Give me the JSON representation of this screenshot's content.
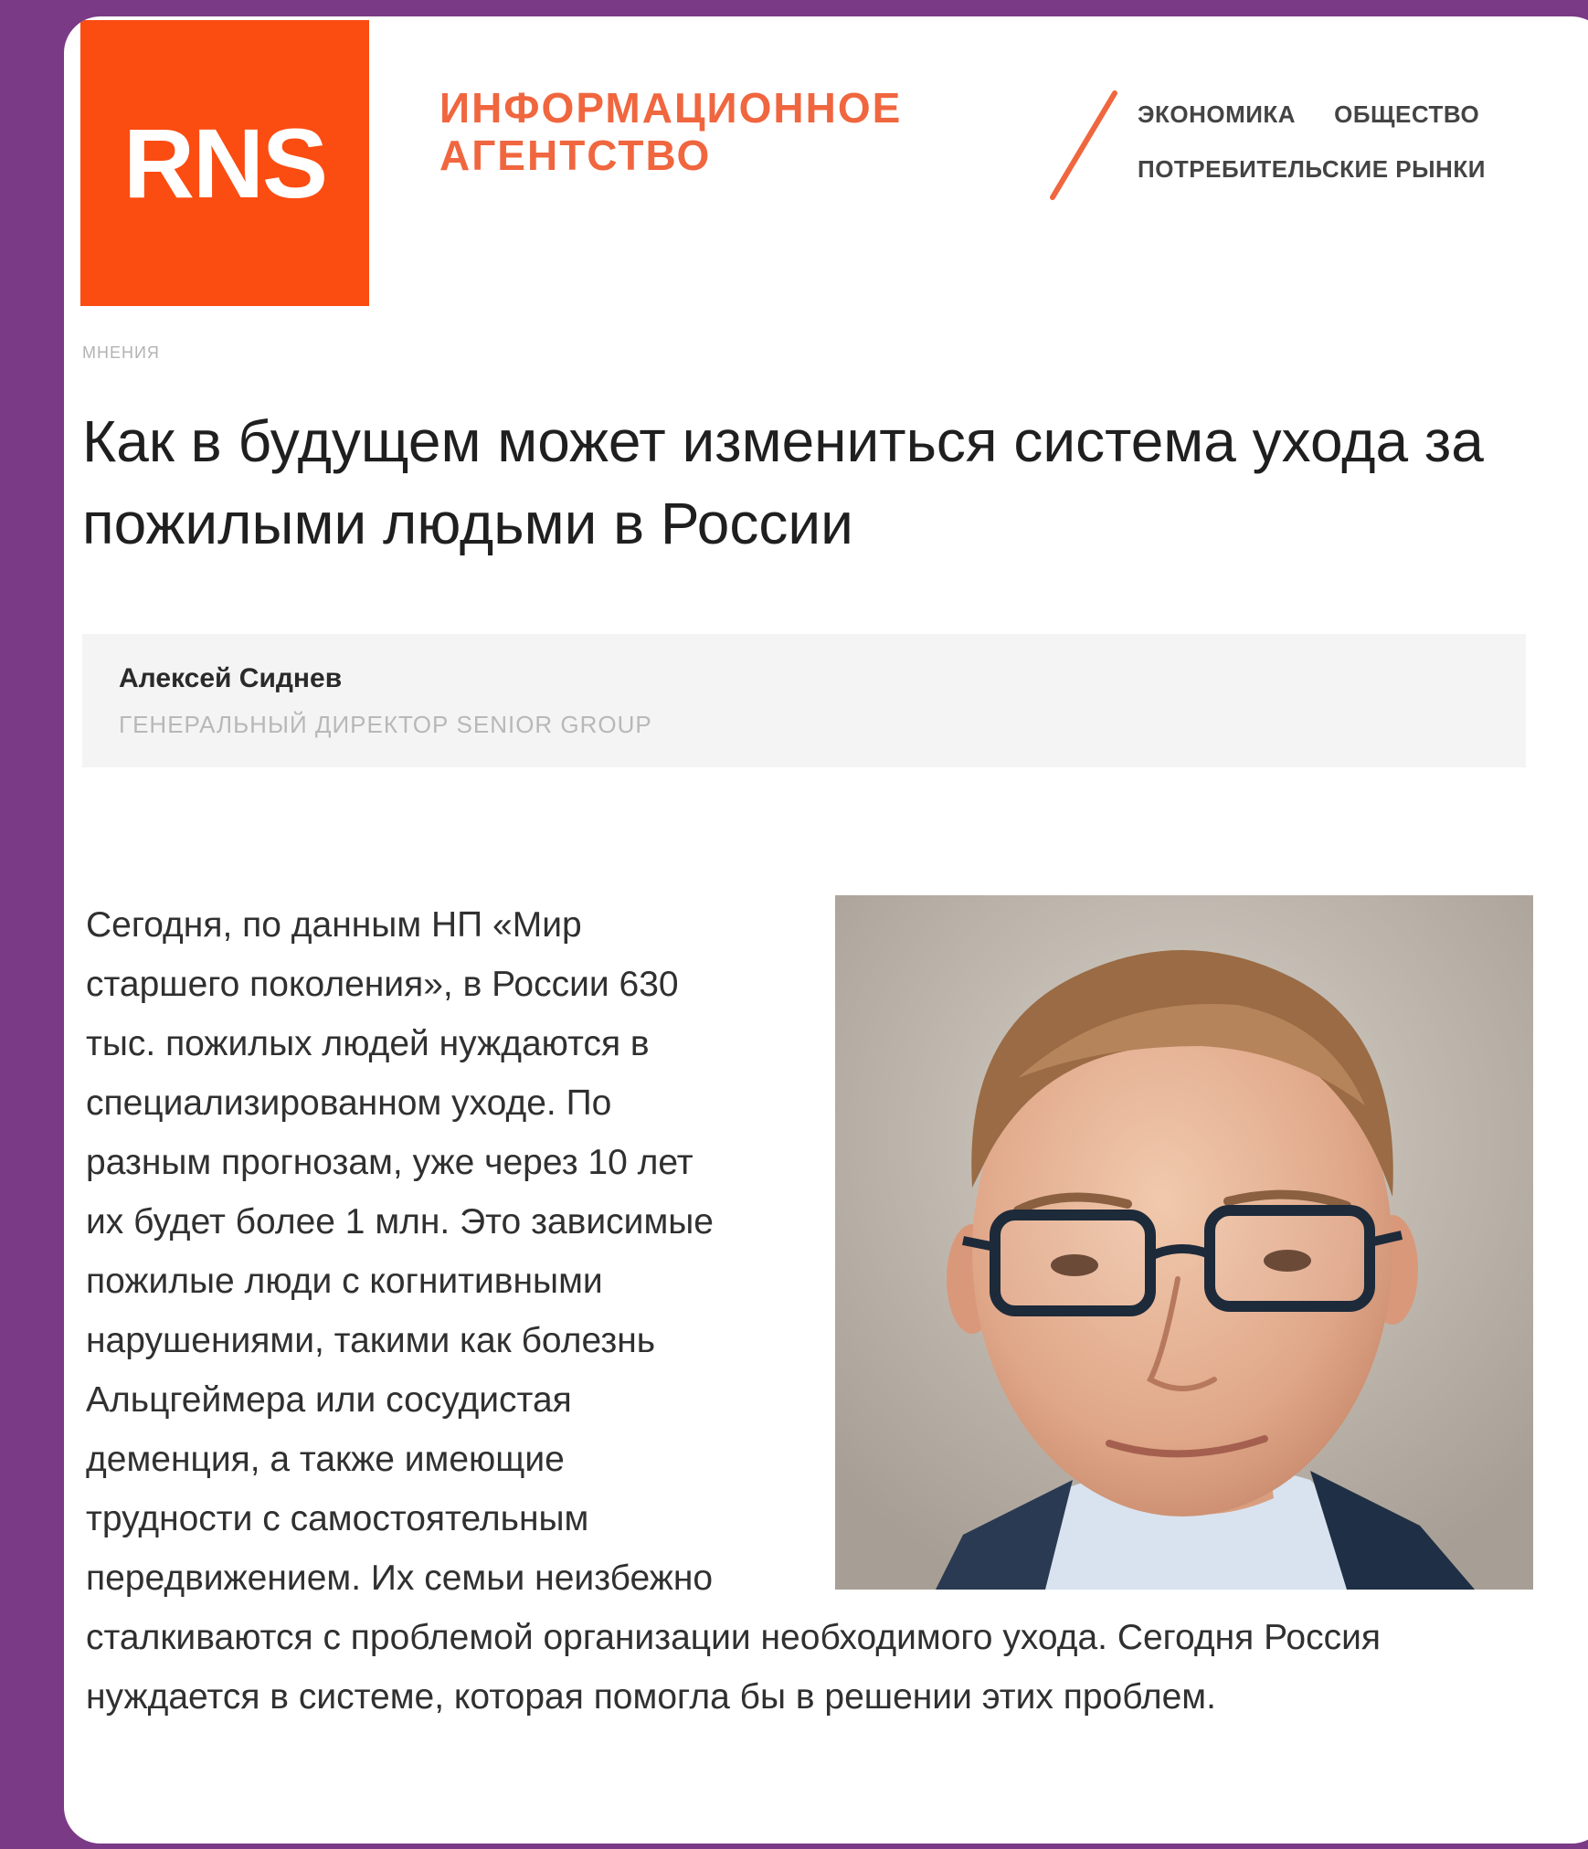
{
  "header": {
    "logo_text": "RNS",
    "agency_line1": "ИНФОРМАЦИОННОЕ",
    "agency_line2": "АГЕНТСТВО",
    "nav_row1": [
      "ЭКОНОМИКА",
      "ОБЩЕСТВО"
    ],
    "nav_row2": [
      "ПОТРЕБИТЕЛЬСКИЕ РЫНКИ"
    ]
  },
  "article": {
    "rubric": "МНЕНИЯ",
    "title": "Как в будущем может измениться система ухода за пожилыми людьми в России",
    "author": {
      "name": "Алексей Сиднев",
      "role": "ГЕНЕРАЛЬНЫЙ ДИРЕКТОР SENIOR GROUP"
    },
    "photo_icon": "portrait-photo",
    "body": "Сегодня, по данным НП «Мир старшего поколения», в России 630 тыс. пожилых людей нуждаются в специализированном уходе. По разным прогнозам, уже через 10 лет их будет более 1 млн. Это зависимые пожилые люди с когнитивными нарушениями, такими как болезнь Альцгеймера или сосудистая деменция, а также имеющие трудности с самостоятельным передвижением. Их семьи неизбежно сталкиваются с проблемой организации необходимого ухода. Сегодня Россия нуждается в системе, которая помогла бы в решении этих проблем."
  },
  "colors": {
    "background": "#7a3a86",
    "brand": "#fb4c12",
    "agency_text": "#f0663f"
  }
}
